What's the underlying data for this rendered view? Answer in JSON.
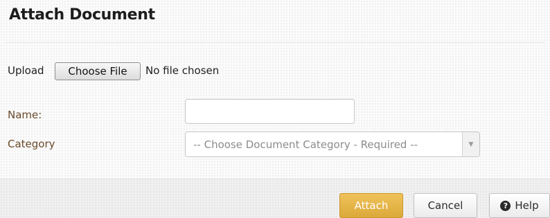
{
  "dialog": {
    "title": "Attach Document"
  },
  "upload": {
    "label": "Upload",
    "button_label": "Choose File",
    "status": "No file chosen"
  },
  "form": {
    "name_label": "Name:",
    "name_value": "",
    "category_label": "Category",
    "category_selected": "-- Choose Document Category - Required --"
  },
  "footer": {
    "attach_label": "Attach",
    "cancel_label": "Cancel",
    "help_label": "Help",
    "help_icon_glyph": "?"
  },
  "icons": {
    "help": "question-circle-icon",
    "dropdown": "caret-down-icon"
  },
  "colors": {
    "attach_button": "#e0ad40",
    "label_text": "#6a4a2a"
  }
}
